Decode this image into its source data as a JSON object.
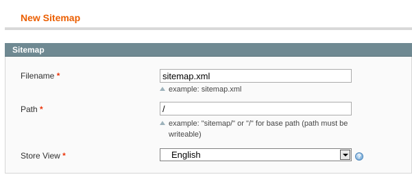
{
  "page": {
    "title": "New Sitemap"
  },
  "fieldset": {
    "title": "Sitemap"
  },
  "fields": {
    "filename": {
      "label": "Filename",
      "required_mark": "*",
      "value": "sitemap.xml",
      "note": "example: sitemap.xml"
    },
    "path": {
      "label": "Path",
      "required_mark": "*",
      "value": "/",
      "note_line1": "example: \"sitemap/\" or \"/\" for base path (path must be",
      "note_line2": "writeable)"
    },
    "store_view": {
      "label": "Store View",
      "required_mark": "*",
      "selected": "English",
      "help_glyph": "?"
    }
  },
  "colors": {
    "title": "#eb5e00",
    "header_bg": "#6f8992",
    "required": "#eb340a"
  },
  "icons": {
    "note_arrow": "triangle-up-icon",
    "help": "help-icon",
    "dropdown": "chevron-down-icon"
  }
}
